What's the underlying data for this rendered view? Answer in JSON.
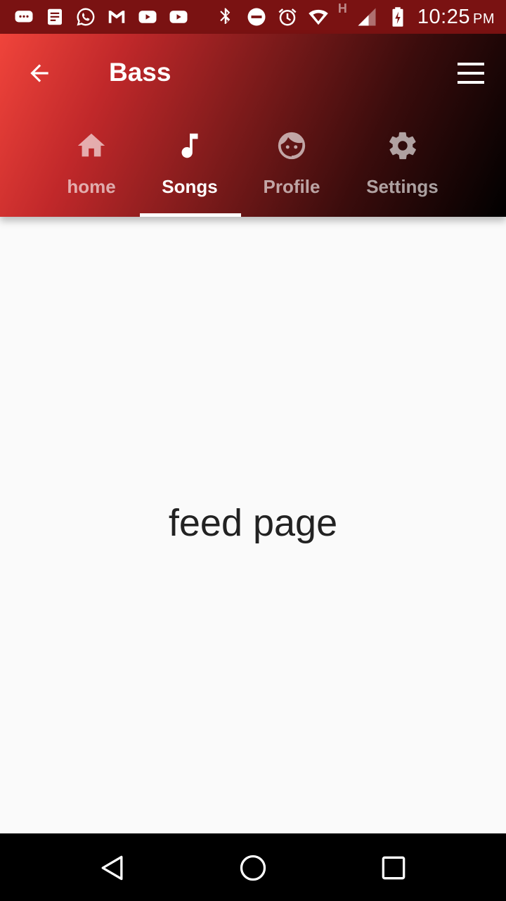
{
  "status_bar": {
    "time": "10:25",
    "ampm": "PM",
    "network_label": "H",
    "left_icons": [
      "messages-icon",
      "notes-icon",
      "whatsapp-icon",
      "gmail-icon",
      "youtube-icon",
      "youtube-icon"
    ],
    "right_icons": [
      "bluetooth-icon",
      "do-not-disturb-icon",
      "alarm-icon",
      "wifi-icon",
      "signal-icon",
      "battery-charging-icon"
    ]
  },
  "app_bar": {
    "title": "Bass",
    "gradient_colors": [
      "#f0443b",
      "#000000"
    ]
  },
  "tabs": [
    {
      "label": "home",
      "icon": "home-icon",
      "active": false
    },
    {
      "label": "Songs",
      "icon": "music-note-icon",
      "active": true
    },
    {
      "label": "Profile",
      "icon": "face-icon",
      "active": false
    },
    {
      "label": "Settings",
      "icon": "gear-icon",
      "active": false
    }
  ],
  "content": {
    "text": "feed page"
  }
}
